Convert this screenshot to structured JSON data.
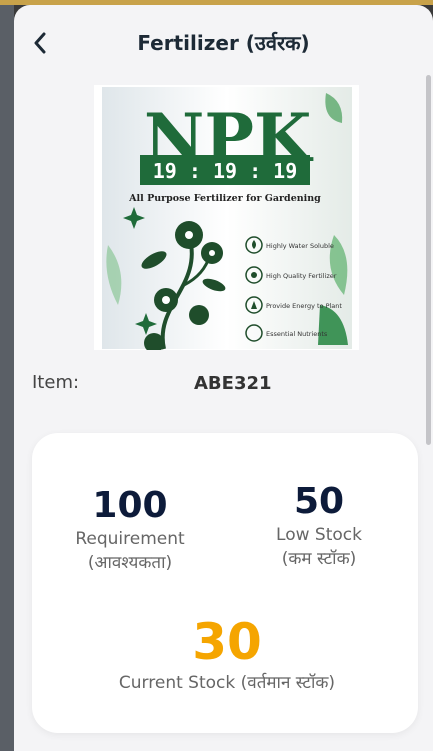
{
  "header": {
    "title": "Fertilizer (उर्वरक)"
  },
  "product": {
    "brand": "NPK",
    "ratio": "19 : 19 : 19",
    "tagline": "All Purpose Fertilizer for Gardening",
    "features": [
      "Highly Water Soluble",
      "High Quality Fertilizer",
      "Provide Energy to Plant",
      "Essential Nutrients"
    ]
  },
  "item": {
    "label": "Item:",
    "value": "ABE321"
  },
  "stats": {
    "requirement": {
      "value": "100",
      "label": "Requirement",
      "label_hi": "(आवश्यकता)"
    },
    "low_stock": {
      "value": "50",
      "label": "Low Stock",
      "label_hi": "(कम स्टॉक)"
    },
    "current_stock": {
      "value": "30",
      "label": "Current Stock (वर्तमान स्टॉक)"
    }
  },
  "colors": {
    "accent": "#f5a500",
    "brand_green": "#1f6b3a",
    "number": "#0d1b3a"
  }
}
